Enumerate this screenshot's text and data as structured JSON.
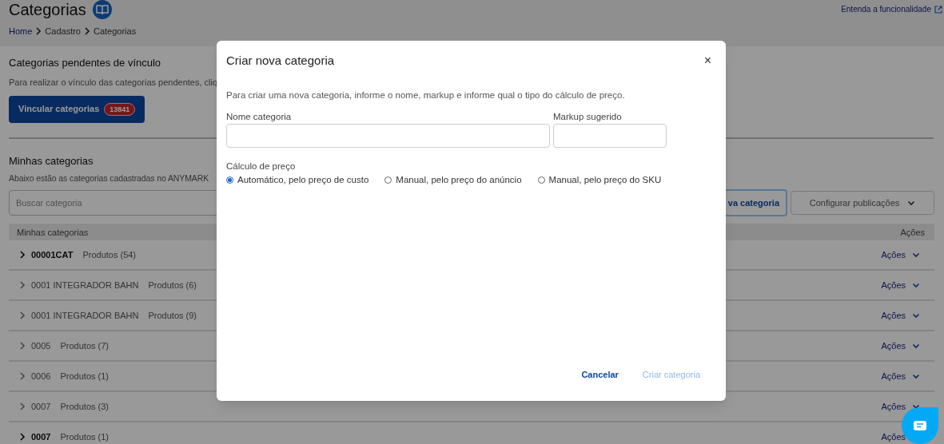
{
  "page": {
    "title": "Categorias",
    "help_link": "Entenda a funcionalidade",
    "breadcrumb": [
      "Home",
      "Cadastro",
      "Categorias"
    ]
  },
  "pending": {
    "heading": "Categorias pendentes de vínculo",
    "description": "Para realizar o vínculo das categorias pendentes, cliq",
    "button": "Vincular categorias",
    "count": "13841"
  },
  "mine": {
    "heading": "Minhas categorias",
    "description": "Abaixo estão as categorias cadastradas no ANYMARK",
    "search_placeholder": "Buscar categoria",
    "new_button": "va categoria",
    "config_button": "Configurar publicações"
  },
  "table": {
    "columns": [
      "Minhas categorias",
      "Ações"
    ],
    "rows": [
      {
        "name": "00001CAT",
        "products": "Produtos (54)",
        "action": "Ações",
        "bold": true
      },
      {
        "name": "0001 INTEGRADOR BAHN",
        "products": "Produtos (6)",
        "action": "Ações",
        "bold": false
      },
      {
        "name": "0001 INTEGRADOR BAHN",
        "products": "Produtos (9)",
        "action": "Ações",
        "bold": false
      },
      {
        "name": "0005",
        "products": "Produtos (7)",
        "action": "Ações",
        "bold": false
      },
      {
        "name": "0006",
        "products": "Produtos (1)",
        "action": "Ações",
        "bold": false
      },
      {
        "name": "0007",
        "products": "Produtos (3)",
        "action": "Ações",
        "bold": false
      },
      {
        "name": "0007",
        "products": "Produtos (1)",
        "action": "Ações",
        "bold": true
      }
    ]
  },
  "dialog": {
    "title": "Criar nova categoria",
    "close": "×",
    "description": "Para criar uma nova categoria, informe o nome, markup e informe qual o tipo do cálculo de preço.",
    "name_label": "Nome categoria",
    "markup_label": "Markup sugerido",
    "price_label": "Cálculo de preço",
    "options": [
      {
        "label": "Automático, pelo preço de custo",
        "selected": true
      },
      {
        "label": "Manual, pelo preço do anúncio",
        "selected": false
      },
      {
        "label": "Manual, pelo preço do SKU",
        "selected": false
      }
    ],
    "cancel": "Cancelar",
    "submit": {
      "label": "Criar categoria",
      "disabled": true
    }
  }
}
